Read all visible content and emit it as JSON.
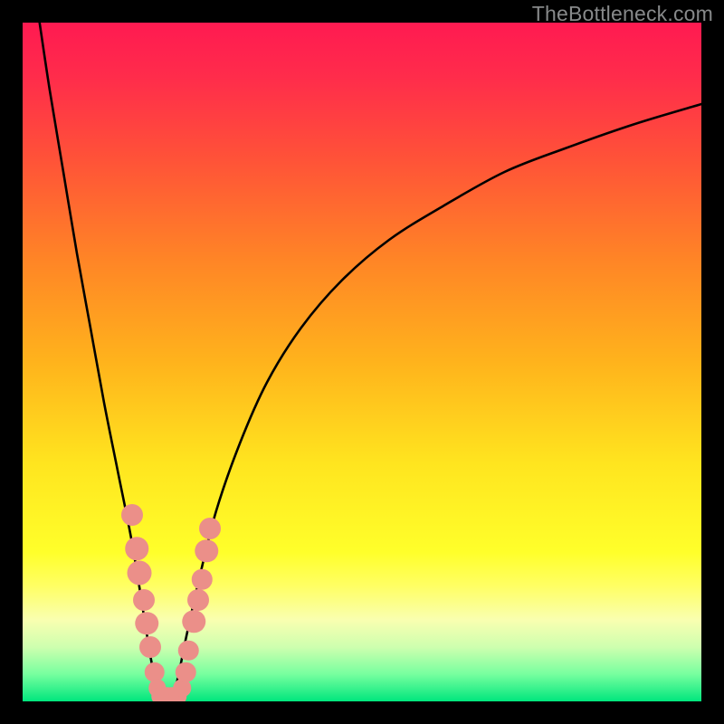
{
  "watermark": "TheBottleneck.com",
  "chart_data": {
    "type": "line",
    "title": "",
    "xlabel": "",
    "ylabel": "",
    "xlim": [
      0,
      100
    ],
    "ylim": [
      0,
      100
    ],
    "gradient_stops": [
      {
        "offset": 0.0,
        "color": "#ff1a51"
      },
      {
        "offset": 0.08,
        "color": "#ff2c4b"
      },
      {
        "offset": 0.2,
        "color": "#ff5238"
      },
      {
        "offset": 0.35,
        "color": "#ff8526"
      },
      {
        "offset": 0.5,
        "color": "#ffb31c"
      },
      {
        "offset": 0.65,
        "color": "#ffe51f"
      },
      {
        "offset": 0.78,
        "color": "#ffff2a"
      },
      {
        "offset": 0.83,
        "color": "#ffff64"
      },
      {
        "offset": 0.88,
        "color": "#f9ffb0"
      },
      {
        "offset": 0.92,
        "color": "#ceffaf"
      },
      {
        "offset": 0.96,
        "color": "#77ff9f"
      },
      {
        "offset": 1.0,
        "color": "#00e67d"
      }
    ],
    "series": [
      {
        "name": "left-branch",
        "x": [
          2.5,
          4.0,
          6.0,
          8.0,
          10.0,
          12.0,
          14.0,
          16.0,
          17.5,
          18.6,
          19.5,
          20.0
        ],
        "values": [
          100,
          90,
          78,
          66,
          55,
          44,
          34,
          24,
          15,
          8,
          3,
          0
        ]
      },
      {
        "name": "right-branch",
        "x": [
          22.0,
          23.0,
          24.0,
          26.0,
          28.5,
          32.0,
          36.0,
          41.0,
          47.0,
          54.0,
          62.0,
          71.0,
          80.0,
          90.0,
          100.0
        ],
        "values": [
          0,
          4,
          9,
          18,
          28,
          38,
          47,
          55,
          62,
          68,
          73,
          78,
          81.5,
          85,
          88
        ]
      }
    ],
    "markers": [
      {
        "x": 16.1,
        "y": 27.5,
        "r": 1.6
      },
      {
        "x": 16.8,
        "y": 22.5,
        "r": 1.7
      },
      {
        "x": 17.2,
        "y": 19.0,
        "r": 1.8
      },
      {
        "x": 17.8,
        "y": 15.0,
        "r": 1.6
      },
      {
        "x": 18.3,
        "y": 11.5,
        "r": 1.7
      },
      {
        "x": 18.8,
        "y": 8.0,
        "r": 1.6
      },
      {
        "x": 19.4,
        "y": 4.3,
        "r": 1.5
      },
      {
        "x": 19.8,
        "y": 2.0,
        "r": 1.3
      },
      {
        "x": 20.3,
        "y": 0.8,
        "r": 1.3
      },
      {
        "x": 21.2,
        "y": 0.8,
        "r": 1.3
      },
      {
        "x": 22.0,
        "y": 0.8,
        "r": 1.3
      },
      {
        "x": 22.8,
        "y": 0.8,
        "r": 1.3
      },
      {
        "x": 23.5,
        "y": 2.0,
        "r": 1.3
      },
      {
        "x": 24.0,
        "y": 4.3,
        "r": 1.5
      },
      {
        "x": 24.4,
        "y": 7.5,
        "r": 1.5
      },
      {
        "x": 25.2,
        "y": 11.8,
        "r": 1.7
      },
      {
        "x": 25.9,
        "y": 15.0,
        "r": 1.6
      },
      {
        "x": 26.4,
        "y": 18.0,
        "r": 1.5
      },
      {
        "x": 27.1,
        "y": 22.2,
        "r": 1.7
      },
      {
        "x": 27.6,
        "y": 25.5,
        "r": 1.6
      }
    ]
  }
}
